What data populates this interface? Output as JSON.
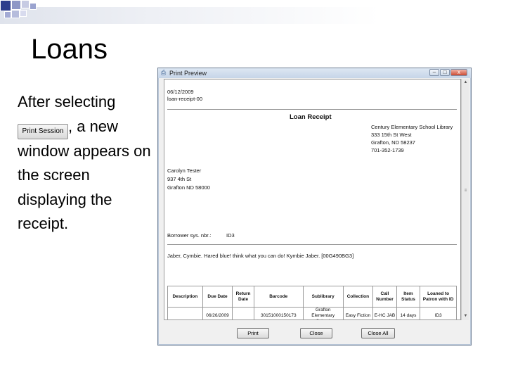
{
  "slide": {
    "title": "Loans",
    "text_before": "After selecting",
    "button_label": "Print Session",
    "text_after": ", a new window appears on the screen displaying the receipt."
  },
  "window": {
    "title": "Print Preview",
    "min_label": "–",
    "max_label": "□",
    "close_label": "x"
  },
  "receipt": {
    "date": "06/12/2009",
    "doc_id": "loan-receipt-00",
    "heading": "Loan Receipt",
    "library": [
      "Century Elementary School Library",
      "333 15th St West",
      "Grafton, ND 58237",
      "701-352-1739"
    ],
    "patron": [
      "Carolyn Tester",
      "937 4th St",
      "Grafton ND 58000"
    ],
    "borrower_label": "Borrower sys. nbr.:",
    "borrower_value": "ID3",
    "item_line": "Jaber, Cymbie. Hared blue! think what you can do! Kymbie Jaber. [00G490BG3]",
    "columns": [
      "Description",
      "Due Date",
      "Return Date",
      "Barcode",
      "Sublibrary",
      "Collection",
      "Call Number",
      "Item Status",
      "Loaned to Patron with ID"
    ],
    "row": [
      "",
      "06/26/2009",
      "",
      "30151000150173",
      "Grafton Elementary School",
      "Easy Fiction",
      "E-HC JAB",
      "14 days",
      "ID3"
    ]
  },
  "buttons": {
    "print": "Print",
    "close": "Close",
    "close_all": "Close All"
  },
  "colors": {
    "title_bar": "#c6d5e8",
    "close_button": "#cc4a33"
  }
}
